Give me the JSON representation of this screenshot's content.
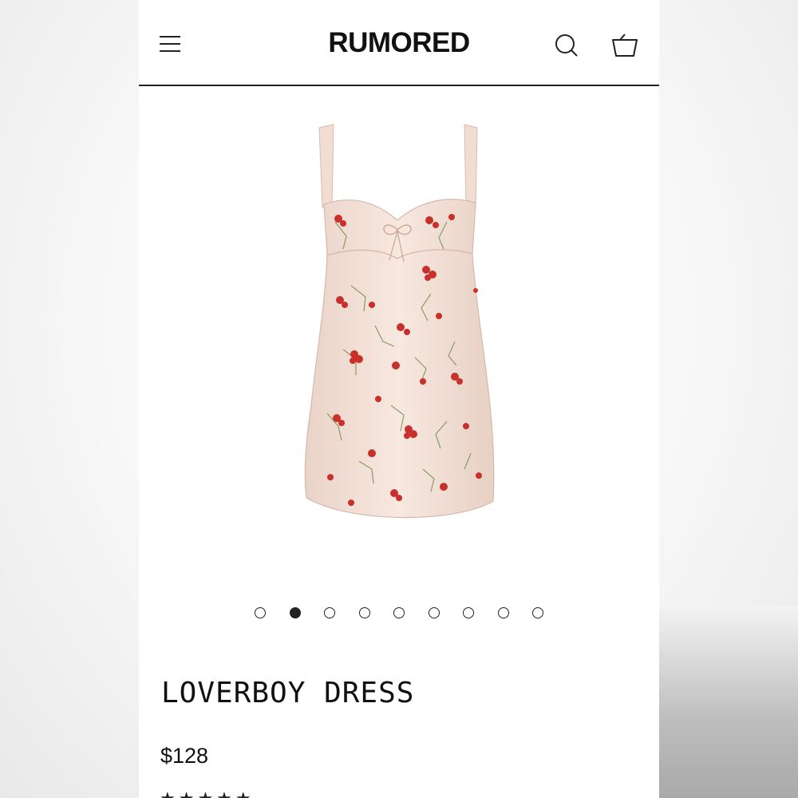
{
  "header": {
    "brand": "RUMORED",
    "icons": {
      "menu": "menu-icon",
      "search": "search-icon",
      "cart": "cart-icon"
    }
  },
  "gallery": {
    "image": "floral-dress-product-image",
    "total_images": 9,
    "active_index": 1
  },
  "product": {
    "title": "LOVERBOY DRESS",
    "price": "$128",
    "rating_stars": "★★★★★"
  },
  "colors": {
    "text": "#111111",
    "fabric": "#f4e2d8",
    "flower": "#c8302b",
    "leaf": "#6f8a45"
  }
}
